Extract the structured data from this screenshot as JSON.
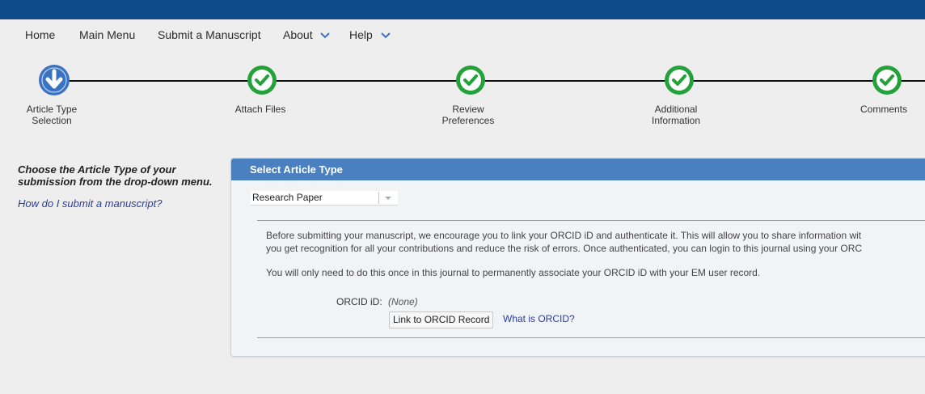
{
  "nav": {
    "items": [
      {
        "label": "Home"
      },
      {
        "label": "Main Menu"
      },
      {
        "label": "Submit a Manuscript"
      },
      {
        "label": "About",
        "dropdown": true
      },
      {
        "label": "Help",
        "dropdown": true
      }
    ]
  },
  "steps": [
    {
      "label_line1": "Article Type",
      "label_line2": "Selection",
      "state": "current"
    },
    {
      "label_line1": "Attach Files",
      "label_line2": "",
      "state": "complete"
    },
    {
      "label_line1": "Review",
      "label_line2": "Preferences",
      "state": "complete"
    },
    {
      "label_line1": "Additional",
      "label_line2": "Information",
      "state": "complete"
    },
    {
      "label_line1": "Comments",
      "label_line2": "",
      "state": "complete"
    }
  ],
  "sidebar": {
    "instruction": "Choose the Article Type of your submission from the drop-down menu.",
    "help_link": "How do I submit a manuscript?"
  },
  "panel": {
    "title": "Select Article Type",
    "article_type": "Research Paper",
    "orcid": {
      "text_line1": "Before submitting your manuscript, we encourage you to link your ORCID iD and authenticate it. This will allow you to share information wit",
      "text_line2": "you get recognition for all your contributions and reduce the risk of errors. Once authenticated, you can login to this journal using your ORC",
      "text_line3": "You will only need to do this once in this journal to permanently associate your ORCID iD with your EM user record.",
      "id_label": "ORCID iD:",
      "id_value": "(None)",
      "link_button": "Link to ORCID Record",
      "what_link": "What is ORCID?"
    }
  },
  "colors": {
    "topbar": "#0f4a8a",
    "step_current": "#3a73c4",
    "step_complete": "#23a23a",
    "panel_header": "#4a7fc0",
    "link": "#2a3d9a"
  },
  "icons": {
    "current_step": "down-arrow-icon",
    "complete_step": "checkmark-icon",
    "nav_dropdown": "chevron-down-icon"
  }
}
